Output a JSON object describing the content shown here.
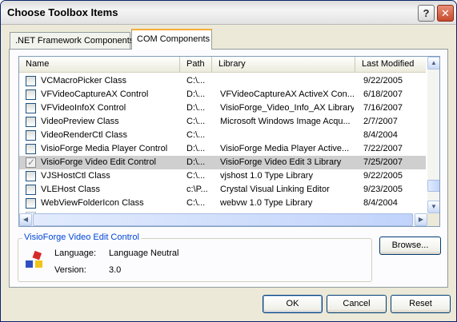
{
  "window": {
    "title": "Choose Toolbox Items",
    "help_label": "?",
    "close_label": "✕"
  },
  "tabs": [
    {
      "label": ".NET Framework Components",
      "active": false
    },
    {
      "label": "COM Components",
      "active": true
    }
  ],
  "list": {
    "columns": [
      "Name",
      "Path",
      "Library",
      "Last Modified"
    ],
    "rows": [
      {
        "checked": false,
        "name": "VCMacroPicker Class",
        "path": "C:\\...",
        "library": "",
        "modified": "9/22/2005"
      },
      {
        "checked": false,
        "name": "VFVideoCaptureAX Control",
        "path": "D:\\...",
        "library": "VFVideoCaptureAX ActiveX Con...",
        "modified": "6/18/2007"
      },
      {
        "checked": false,
        "name": "VFVideoInfoX Control",
        "path": "D:\\...",
        "library": "VisioForge_Video_Info_AX Library",
        "modified": "7/16/2007"
      },
      {
        "checked": false,
        "name": "VideoPreview Class",
        "path": "C:\\...",
        "library": "Microsoft Windows Image Acqu...",
        "modified": "2/7/2007"
      },
      {
        "checked": false,
        "name": "VideoRenderCtl Class",
        "path": "C:\\...",
        "library": "",
        "modified": "8/4/2004"
      },
      {
        "checked": false,
        "name": "VisioForge Media Player Control",
        "path": "D:\\...",
        "library": "VisioForge Media Player Active...",
        "modified": "7/22/2007"
      },
      {
        "checked": true,
        "name": "VisioForge Video Edit Control",
        "path": "D:\\...",
        "library": "VisioForge Video Edit 3 Library",
        "modified": "7/25/2007",
        "selected": true
      },
      {
        "checked": false,
        "name": "VJSHostCtl Class",
        "path": "C:\\...",
        "library": "vjshost 1.0 Type Library",
        "modified": "9/22/2005"
      },
      {
        "checked": false,
        "name": "VLEHost Class",
        "path": "c:\\P...",
        "library": "Crystal Visual Linking Editor",
        "modified": "9/23/2005"
      },
      {
        "checked": false,
        "name": "WebViewFolderIcon Class",
        "path": "C:\\...",
        "library": "webvw 1.0 Type Library",
        "modified": "8/4/2004"
      }
    ]
  },
  "details": {
    "group_title": "VisioForge Video Edit Control",
    "language_label": "Language:",
    "language_value": "Language Neutral",
    "version_label": "Version:",
    "version_value": "3.0"
  },
  "buttons": {
    "browse_label": "Browse...",
    "ok_label": "OK",
    "cancel_label": "Cancel",
    "reset_label": "Reset"
  },
  "colors": {
    "selection": "#cfcfcf",
    "group_title": "#0046d5",
    "close_button": "#c74a2c"
  }
}
